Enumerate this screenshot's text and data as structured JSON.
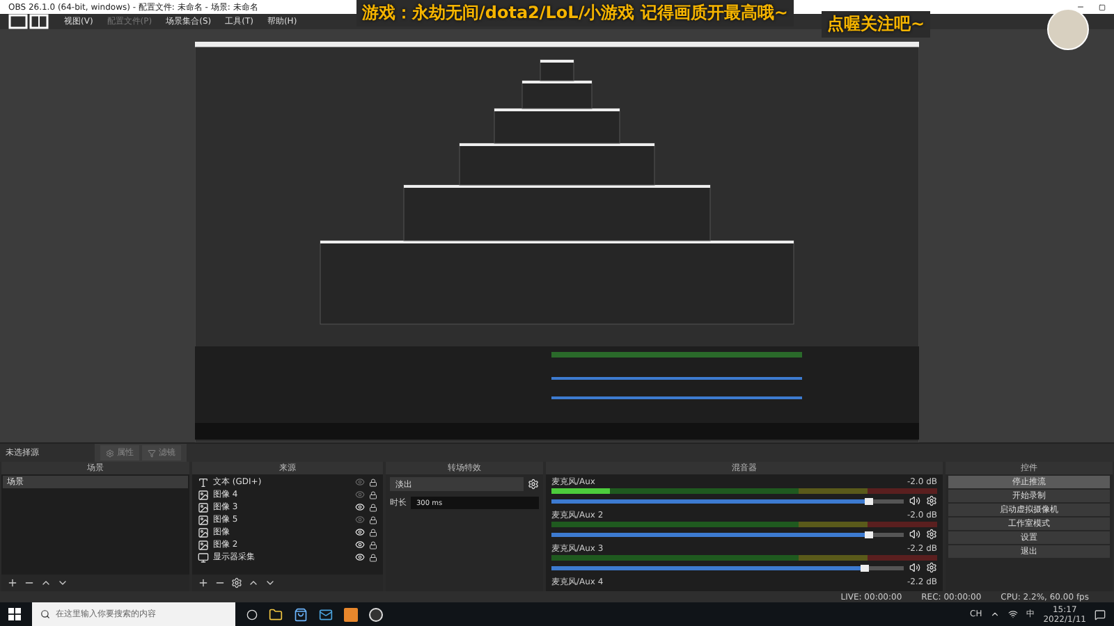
{
  "window": {
    "title": "OBS 26.1.0 (64-bit, windows) - 配置文件: 未命名 - 场景: 未命名"
  },
  "menu": [
    {
      "label": "视图(V)",
      "disabled": false
    },
    {
      "label": "配置文件(P)",
      "disabled": true
    },
    {
      "label": "场景集合(S)",
      "disabled": false
    },
    {
      "label": "工具(T)",
      "disabled": false
    },
    {
      "label": "帮助(H)",
      "disabled": false
    }
  ],
  "overlay": {
    "banner": "游戏：永劫无间/dota2/LoL/小游戏  记得画质开最高哦~",
    "follow": "点喔关注吧~"
  },
  "source_bar": {
    "label": "未选择源",
    "buttons": [
      {
        "label": "属性",
        "kind": "gear"
      },
      {
        "label": "滤镜",
        "kind": "filter"
      }
    ]
  },
  "scenes": {
    "title": "场景",
    "items": [
      {
        "label": "场景",
        "selected": true
      }
    ]
  },
  "sources": {
    "title": "来源",
    "items": [
      {
        "label": "文本 (GDI+)",
        "kind": "text",
        "visible": false
      },
      {
        "label": "图像 4",
        "kind": "image",
        "visible": false
      },
      {
        "label": "图像 3",
        "kind": "image",
        "visible": true
      },
      {
        "label": "图像 5",
        "kind": "image",
        "visible": false
      },
      {
        "label": "图像",
        "kind": "image",
        "visible": true
      },
      {
        "label": "图像 2",
        "kind": "image",
        "visible": true
      },
      {
        "label": "显示器采集",
        "kind": "monitor",
        "visible": true
      }
    ]
  },
  "transitions": {
    "title": "转场特效",
    "value": "淡出",
    "duration_label": "时长",
    "duration": "300 ms"
  },
  "mixer": {
    "title": "混音器",
    "channels": [
      {
        "name": "麦克风/Aux",
        "reading": "-2.0 dB",
        "level": 0.9,
        "meter": {
          "level": 0.15
        }
      },
      {
        "name": "麦克风/Aux 2",
        "reading": "-2.0 dB",
        "level": 0.9
      },
      {
        "name": "麦克风/Aux 3",
        "reading": "-2.2 dB",
        "level": 0.89
      },
      {
        "name": "麦克风/Aux 4",
        "reading": "-2.2 dB"
      }
    ]
  },
  "controls": {
    "title": "控件",
    "buttons": [
      {
        "label": "停止推流",
        "hovered": true
      },
      {
        "label": "开始录制",
        "hovered": false
      },
      {
        "label": "启动虚拟摄像机",
        "hovered": false
      },
      {
        "label": "工作室模式",
        "hovered": false
      },
      {
        "label": "设置",
        "hovered": false
      },
      {
        "label": "退出",
        "hovered": false
      }
    ]
  },
  "status_bar": {
    "live": "LIVE: 00:00:00",
    "rec": "REC: 00:00:00",
    "cpu": "CPU: 2.2%, 60.00 fps"
  },
  "taskbar": {
    "search_placeholder": "在这里输入你要搜索的内容",
    "ime": "CH",
    "lang": "中",
    "time": "15:17",
    "date": "2022/1/11"
  }
}
